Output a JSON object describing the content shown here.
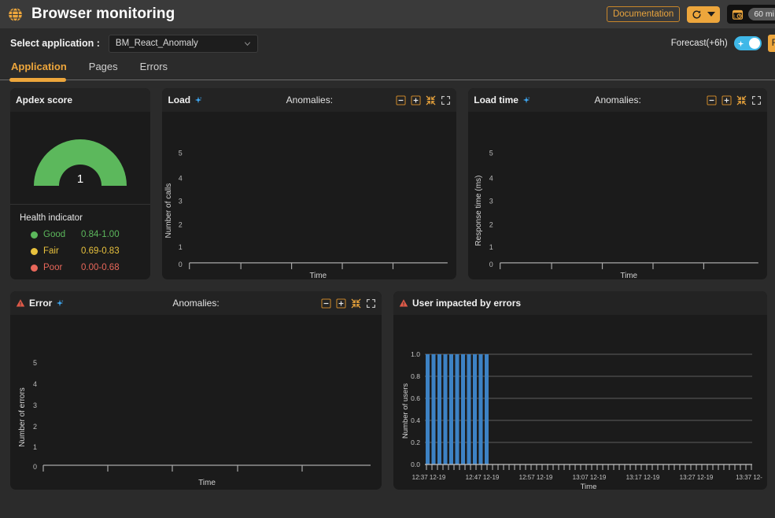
{
  "topbar": {
    "icon": "globe-icon",
    "title": "Browser monitoring",
    "documentation_label": "Documentation",
    "refresh_icon": "refresh-icon",
    "caret_icon": "chevron-down-icon",
    "calendar_icon": "calendar-clock-icon",
    "time_range": "60 mi",
    "accent_color": "#eda63c"
  },
  "selectbar": {
    "label": "Select application :",
    "selected_application": "BM_React_Anomaly",
    "placeholder": "BM_React_Anomaly",
    "chevron_icon": "chevron-down-icon",
    "forecast_label": "Forecast(+6h)",
    "forecast_on": true,
    "toggle_color": "#3fb8e8",
    "edge_button_label": "R"
  },
  "tabs": [
    {
      "label": "Application",
      "active": true
    },
    {
      "label": "Pages",
      "active": false
    },
    {
      "label": "Errors",
      "active": false
    }
  ],
  "apdex": {
    "title": "Apdex score",
    "value": "1",
    "gauge_color": "#5cb85c",
    "health_title": "Health indicator",
    "legend": [
      {
        "name": "Good",
        "range": "0.84-1.00",
        "color": "#5cb85c"
      },
      {
        "name": "Fair",
        "range": "0.69-0.83",
        "color": "#e8c13d"
      },
      {
        "name": "Poor",
        "range": "0.00-0.68",
        "color": "#e8675a"
      }
    ]
  },
  "panels": {
    "load": {
      "title": "Load",
      "sparkle_icon": "ai-sparkle-icon",
      "anomalies_label": "Anomalies:",
      "icons": [
        "zoom-out-icon",
        "zoom-in-icon",
        "collapse-icon",
        "fullscreen-icon"
      ]
    },
    "load_time": {
      "title": "Load time",
      "sparkle_icon": "ai-sparkle-icon",
      "anomalies_label": "Anomalies:",
      "icons": [
        "zoom-out-icon",
        "zoom-in-icon",
        "collapse-icon",
        "fullscreen-icon"
      ]
    },
    "error": {
      "title": "Error",
      "warning_icon": "warning-triangle-icon",
      "sparkle_icon": "ai-sparkle-icon",
      "anomalies_label": "Anomalies:",
      "icons": [
        "zoom-out-icon",
        "zoom-in-icon",
        "collapse-icon",
        "fullscreen-icon"
      ]
    },
    "users": {
      "title": "User impacted by errors",
      "warning_icon": "warning-triangle-icon"
    }
  },
  "chart_data": [
    {
      "id": "load",
      "type": "line",
      "title": "Load",
      "xlabel": "Time",
      "ylabel": "Number of calls",
      "yticks": [
        "0",
        "1",
        "2",
        "3",
        "4",
        "5"
      ],
      "ylim": [
        0,
        5.5
      ],
      "xticks": [
        "",
        "",
        "",
        "",
        "",
        ""
      ],
      "series": [
        {
          "name": "Number of calls",
          "values": []
        }
      ],
      "grid": false,
      "legend": "none"
    },
    {
      "id": "load_time",
      "type": "line",
      "title": "Load time",
      "xlabel": "Time",
      "ylabel": "Response time (ms)",
      "yticks": [
        "0",
        "1",
        "2",
        "3",
        "4",
        "5"
      ],
      "ylim": [
        0,
        5.5
      ],
      "xticks": [
        "",
        "",
        "",
        "",
        "",
        ""
      ],
      "series": [
        {
          "name": "Response time (ms)",
          "values": []
        }
      ],
      "grid": false,
      "legend": "none"
    },
    {
      "id": "error",
      "type": "line",
      "title": "Error",
      "xlabel": "Time",
      "ylabel": "Number of errors",
      "yticks": [
        "0",
        "1",
        "2",
        "3",
        "4",
        "5"
      ],
      "ylim": [
        0,
        5.5
      ],
      "xticks": [
        "",
        "",
        "",
        "",
        "",
        ""
      ],
      "series": [
        {
          "name": "Number of errors",
          "values": []
        }
      ],
      "grid": false,
      "legend": "none"
    },
    {
      "id": "users",
      "type": "bar",
      "title": "User impacted by errors",
      "xlabel": "Time",
      "ylabel": "Number of users",
      "yticks": [
        "0.0",
        "0.2",
        "0.4",
        "0.6",
        "0.8",
        "1.0"
      ],
      "ylim": [
        0,
        1.0
      ],
      "xticks": [
        "12:37 12-19",
        "12:47 12-19",
        "12:57 12-19",
        "13:07 12-19",
        "13:17 12-19",
        "13:27 12-19",
        "13:37 12-"
      ],
      "bar_color": "#3d82c4",
      "categories": [
        "12:37",
        "12:38",
        "12:39",
        "12:40",
        "12:41",
        "12:42",
        "12:43",
        "12:44",
        "12:45",
        "12:46",
        "12:47"
      ],
      "values": [
        1,
        1,
        1,
        1,
        1,
        1,
        1,
        1,
        1,
        1,
        1
      ],
      "grid": true,
      "legend": "none"
    }
  ]
}
